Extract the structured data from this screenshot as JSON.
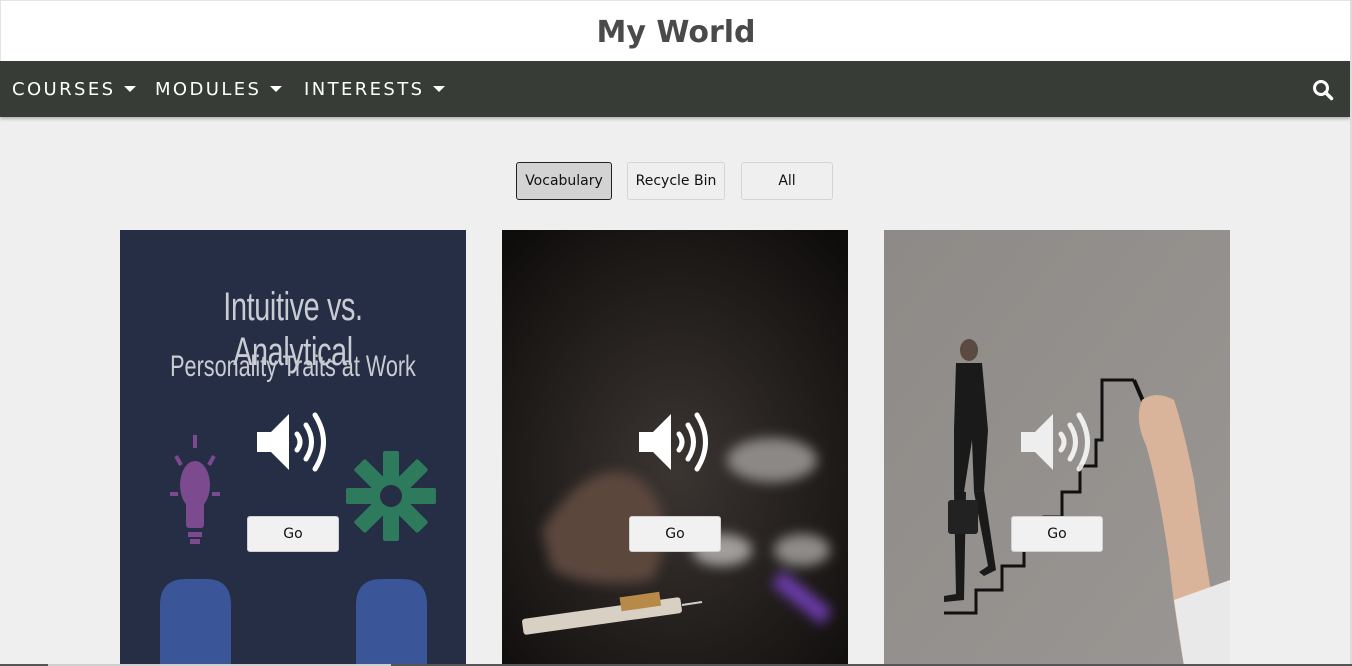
{
  "header": {
    "title": "My World"
  },
  "nav": {
    "items": [
      {
        "label": "COURSES"
      },
      {
        "label": "MODULES"
      },
      {
        "label": "INTERESTS"
      }
    ],
    "search_icon": "search-icon"
  },
  "filters": {
    "buttons": [
      {
        "label": "Vocabulary",
        "active": true
      },
      {
        "label": "Recycle Bin",
        "active": false
      },
      {
        "label": "All",
        "active": false
      }
    ]
  },
  "cards": [
    {
      "title_line1": "Intuitive vs. Analytical",
      "title_line2": "Personality Traits at Work",
      "icon": "speaker-icon",
      "button": "Go"
    },
    {
      "icon": "speaker-icon",
      "button": "Go"
    },
    {
      "icon": "speaker-icon",
      "button": "Go"
    }
  ],
  "colors": {
    "navbar": "#373c36",
    "page_bg": "#efefef",
    "card1_bg": "#252e44",
    "bulb": "#7c4a8e",
    "gear": "#2e7a5c",
    "head": "#3a5598"
  }
}
